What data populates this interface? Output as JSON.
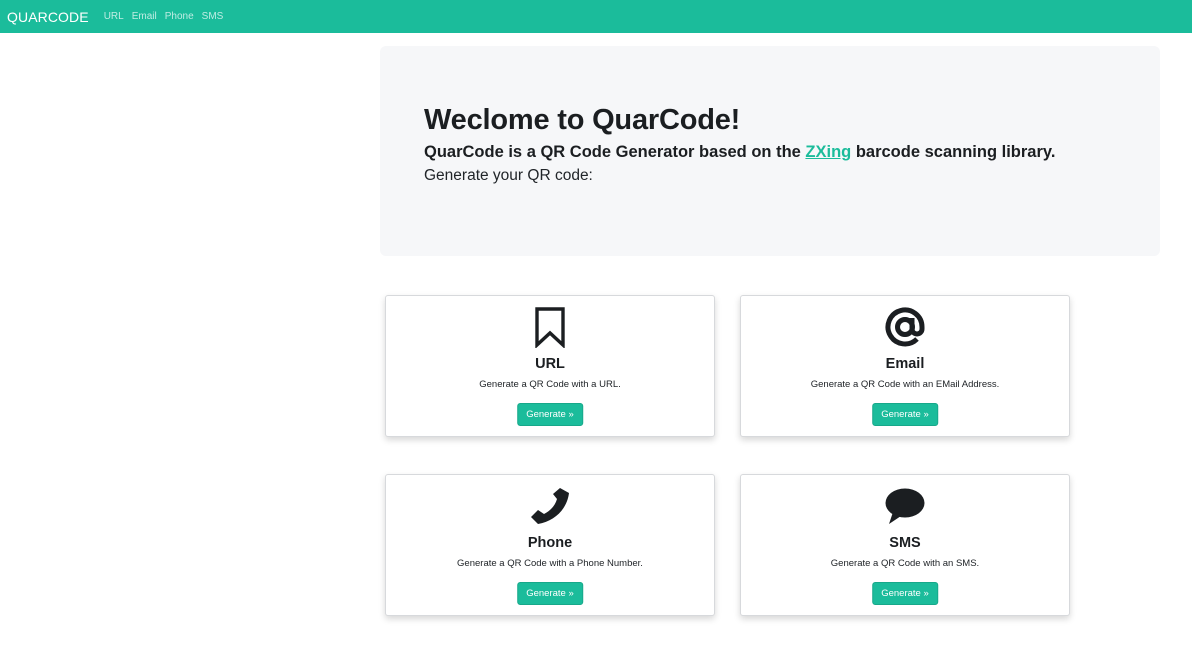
{
  "nav": {
    "brand": "QUARCODE",
    "links": [
      "URL",
      "Email",
      "Phone",
      "SMS"
    ]
  },
  "jumbotron": {
    "heading": "Weclome to QuarCode!",
    "subheading_before": "QuarCode is a QR Code Generator based on the ",
    "subheading_link": "ZXing",
    "subheading_after": " barcode scanning library.",
    "text": "Generate your QR code:"
  },
  "cards": [
    {
      "icon": "bookmark-icon",
      "title": "URL",
      "desc": "Generate a QR Code with a URL.",
      "button": "Generate »"
    },
    {
      "icon": "at-sign-icon",
      "title": "Email",
      "desc": "Generate a QR Code with an EMail Address.",
      "button": "Generate »"
    },
    {
      "icon": "phone-icon",
      "title": "Phone",
      "desc": "Generate a QR Code with a Phone Number.",
      "button": "Generate »"
    },
    {
      "icon": "speech-bubble-icon",
      "title": "SMS",
      "desc": "Generate a QR Code with an SMS.",
      "button": "Generate »"
    }
  ],
  "colors": {
    "accent": "#1bbc9b",
    "jumbotron_bg": "#f6f7f9",
    "text": "#212529"
  }
}
